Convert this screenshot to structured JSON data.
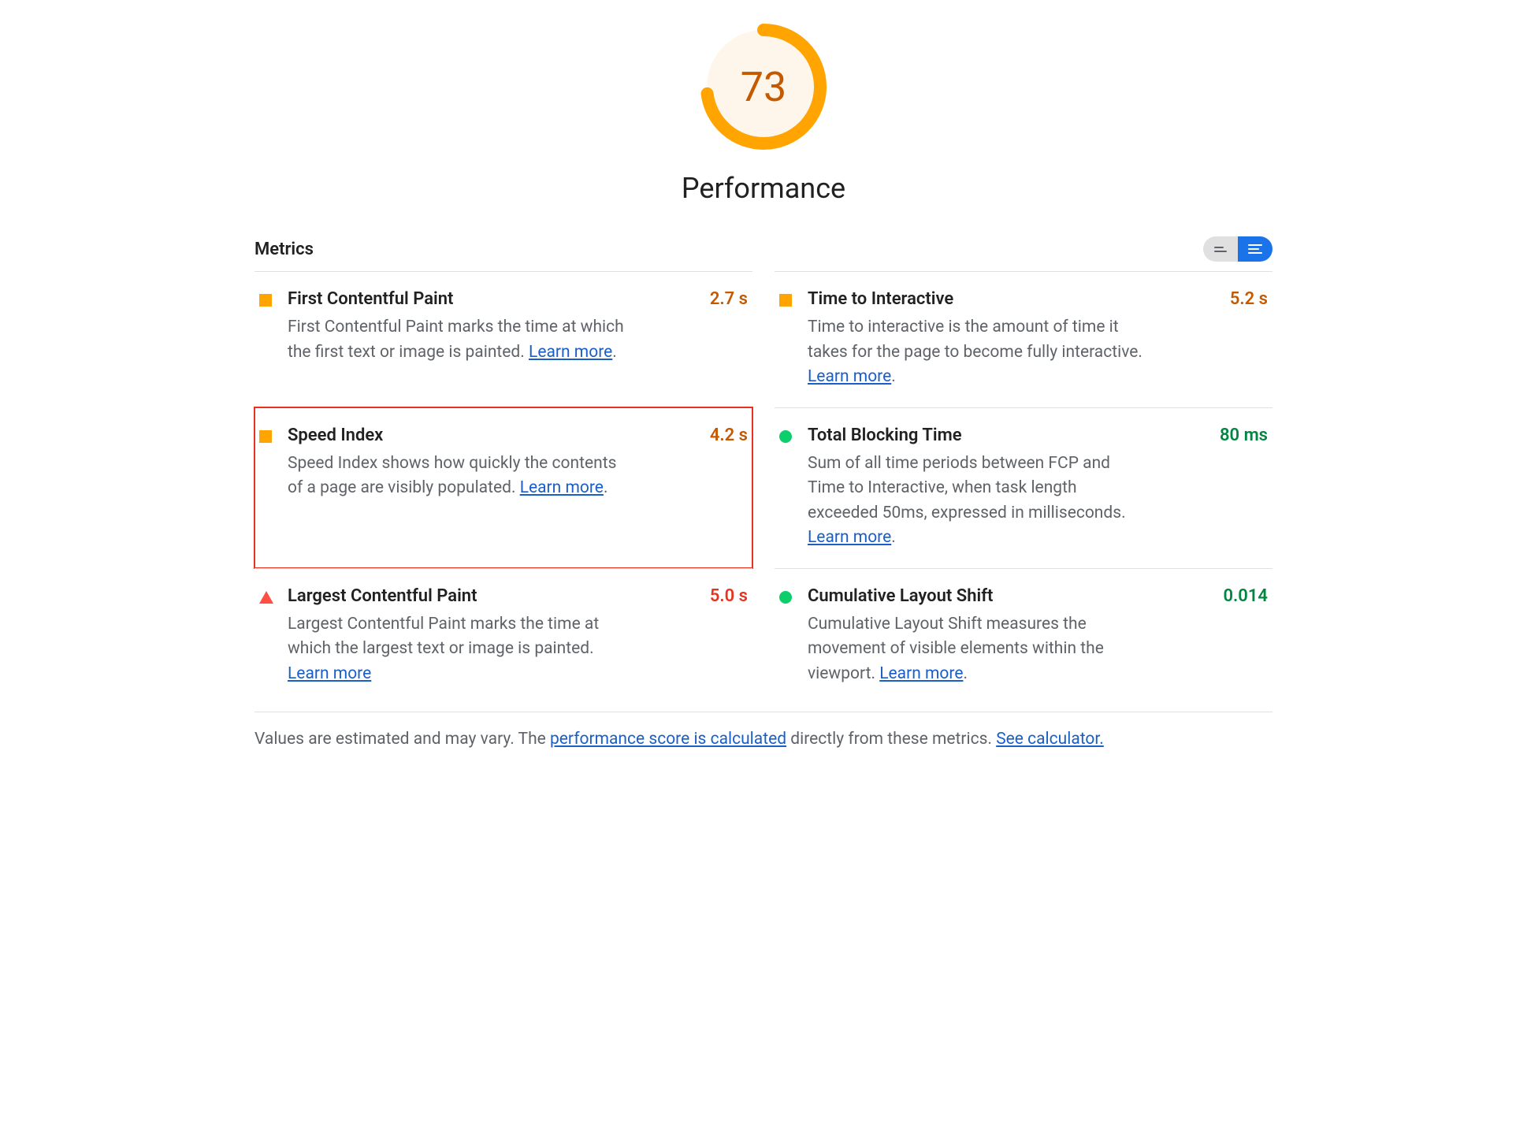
{
  "gauge": {
    "score": "73",
    "score_num": 73,
    "arc_color": "#FFA400",
    "bg_color": "#FFF6EB"
  },
  "category_title": "Performance",
  "metrics_title": "Metrics",
  "learn_more_label": "Learn more",
  "view_toggle": {
    "collapsed_label": "collapsed view",
    "expanded_label": "expanded view",
    "active": "expanded"
  },
  "metrics": [
    {
      "id": "first-contentful-paint",
      "name": "First Contentful Paint",
      "value": "2.7 s",
      "status": "average",
      "value_class": "value-orange",
      "desc_pre": "First Contentful Paint marks the time at which the first text or image is painted. ",
      "desc_post": ".",
      "highlighted": false
    },
    {
      "id": "time-to-interactive",
      "name": "Time to Interactive",
      "value": "5.2 s",
      "status": "average",
      "value_class": "value-orange",
      "desc_pre": "Time to interactive is the amount of time it takes for the page to become fully interactive. ",
      "desc_post": ".",
      "highlighted": false
    },
    {
      "id": "speed-index",
      "name": "Speed Index",
      "value": "4.2 s",
      "status": "average",
      "value_class": "value-orange",
      "desc_pre": "Speed Index shows how quickly the contents of a page are visibly populated. ",
      "desc_post": ".",
      "highlighted": true
    },
    {
      "id": "total-blocking-time",
      "name": "Total Blocking Time",
      "value": "80 ms",
      "status": "good",
      "value_class": "value-green",
      "desc_pre": "Sum of all time periods between FCP and Time to Interactive, when task length exceeded 50ms, expressed in milliseconds. ",
      "desc_post": ".",
      "highlighted": false
    },
    {
      "id": "largest-contentful-paint",
      "name": "Largest Contentful Paint",
      "value": "5.0 s",
      "status": "poor",
      "value_class": "value-red",
      "desc_pre": "Largest Contentful Paint marks the time at which the largest text or image is painted. ",
      "desc_post": "",
      "highlighted": false
    },
    {
      "id": "cumulative-layout-shift",
      "name": "Cumulative Layout Shift",
      "value": "0.014",
      "status": "good",
      "value_class": "value-green",
      "desc_pre": "Cumulative Layout Shift measures the movement of visible elements within the viewport. ",
      "desc_post": ".",
      "highlighted": false
    }
  ],
  "footer": {
    "text_pre": "Values are estimated and may vary. The ",
    "link1": "performance score is calculated",
    "text_mid": " directly from these metrics. ",
    "link2": "See calculator."
  }
}
